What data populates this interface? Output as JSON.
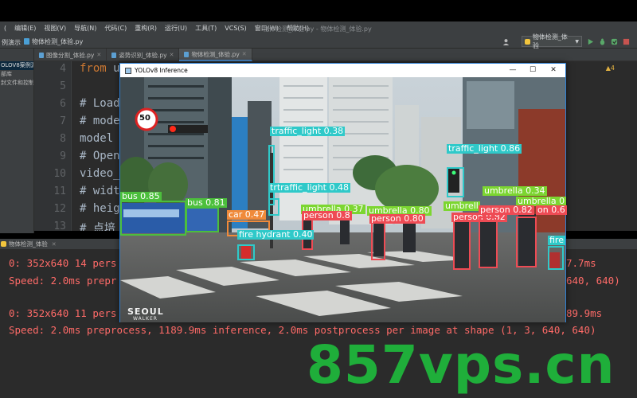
{
  "ide": {
    "menu": [
      "(",
      "编辑(E)",
      "视图(V)",
      "导航(N)",
      "代码(C)",
      "重构(R)",
      "运行(U)",
      "工具(T)",
      "VCS(S)",
      "窗口(W)",
      "帮助(H)"
    ],
    "window_title": "物体检测_体验.py - 物体检测_体验.py",
    "breadcrumb": "例演示",
    "current_file": "物体检测_体验.py",
    "run_config": "物体检测_体验",
    "tabs": [
      {
        "label": "图像分割_体验.py",
        "active": false
      },
      {
        "label": "姿势识别_体验.py",
        "active": false
      },
      {
        "label": "物体检测_体验.py",
        "active": true
      }
    ],
    "project_items": [
      "OLOV8案例源",
      "部库",
      "封文件和控制"
    ],
    "warnings": "▲4"
  },
  "editor": {
    "line_numbers": [
      "4",
      "5",
      "6",
      "7",
      "8",
      "9",
      "10",
      "11",
      "12",
      "13"
    ],
    "lines": [
      {
        "kw": "from",
        "rest": " ul"
      },
      {
        "kw": "",
        "rest": ""
      },
      {
        "comment": "# Load"
      },
      {
        "comment": "# model"
      },
      {
        "kw": "",
        "rest": "model ="
      },
      {
        "comment": "# Open"
      },
      {
        "kw": "",
        "rest": "video_p"
      },
      {
        "comment": "# width"
      },
      {
        "comment": "# heigh"
      },
      {
        "comment": "# 点培"
      }
    ]
  },
  "run": {
    "tab_label": "物体检测_体验",
    "line1_left": "0: 352x640 14 pers",
    "line1_right": "7.7ms",
    "line2_left": "Speed: 2.0ms prepr",
    "line2_right": "640, 640)",
    "line3_left": "0: 352x640 11 pers",
    "line3_right": "89.9ms",
    "line4": "Speed: 2.0ms preprocess, 1189.9ms inference, 2.0ms postprocess per image at shape (1, 3, 640, 640)"
  },
  "inference_window": {
    "title": "YOLOv8 Inference",
    "minimize": "—",
    "maximize": "☐",
    "close": "✕",
    "sign_speed": "50",
    "brand_line1": "SEOUL",
    "brand_line2": "WALKER",
    "detections": [
      {
        "label": "traffic_light 0.38",
        "color": "#2fc9c9"
      },
      {
        "label": "traffic_light 0.86",
        "color": "#2fc9c9"
      },
      {
        "label": "trtraffic_light 0.48",
        "color": "#2fc9c9"
      },
      {
        "label": "umbrella 0.34",
        "color": "#7cd631"
      },
      {
        "label": "umbrella 0",
        "color": "#7cd631"
      },
      {
        "label": "bus 0.85",
        "color": "#4cbf3c"
      },
      {
        "label": "bus 0.81",
        "color": "#4cbf3c"
      },
      {
        "label": "car 0.47",
        "color": "#f08a3a"
      },
      {
        "label": "umbrella 0.37",
        "color": "#7cd631"
      },
      {
        "label": "umbrella 0.80",
        "color": "#7cd631"
      },
      {
        "label": "umbrell",
        "color": "#7cd631"
      },
      {
        "label": "person 0.8",
        "color": "#ee4b54"
      },
      {
        "label": "person 0.80",
        "color": "#ee4b54"
      },
      {
        "label": "person 0.82",
        "color": "#ee4b54"
      },
      {
        "label": "person 0.82",
        "color": "#ee4b54"
      },
      {
        "label": "on 0.6",
        "color": "#ee4b54"
      },
      {
        "label": "fire hydrant 0.40",
        "color": "#2fc9c9"
      },
      {
        "label": "fire",
        "color": "#2fc9c9"
      }
    ]
  },
  "watermark": "857vps.cn"
}
